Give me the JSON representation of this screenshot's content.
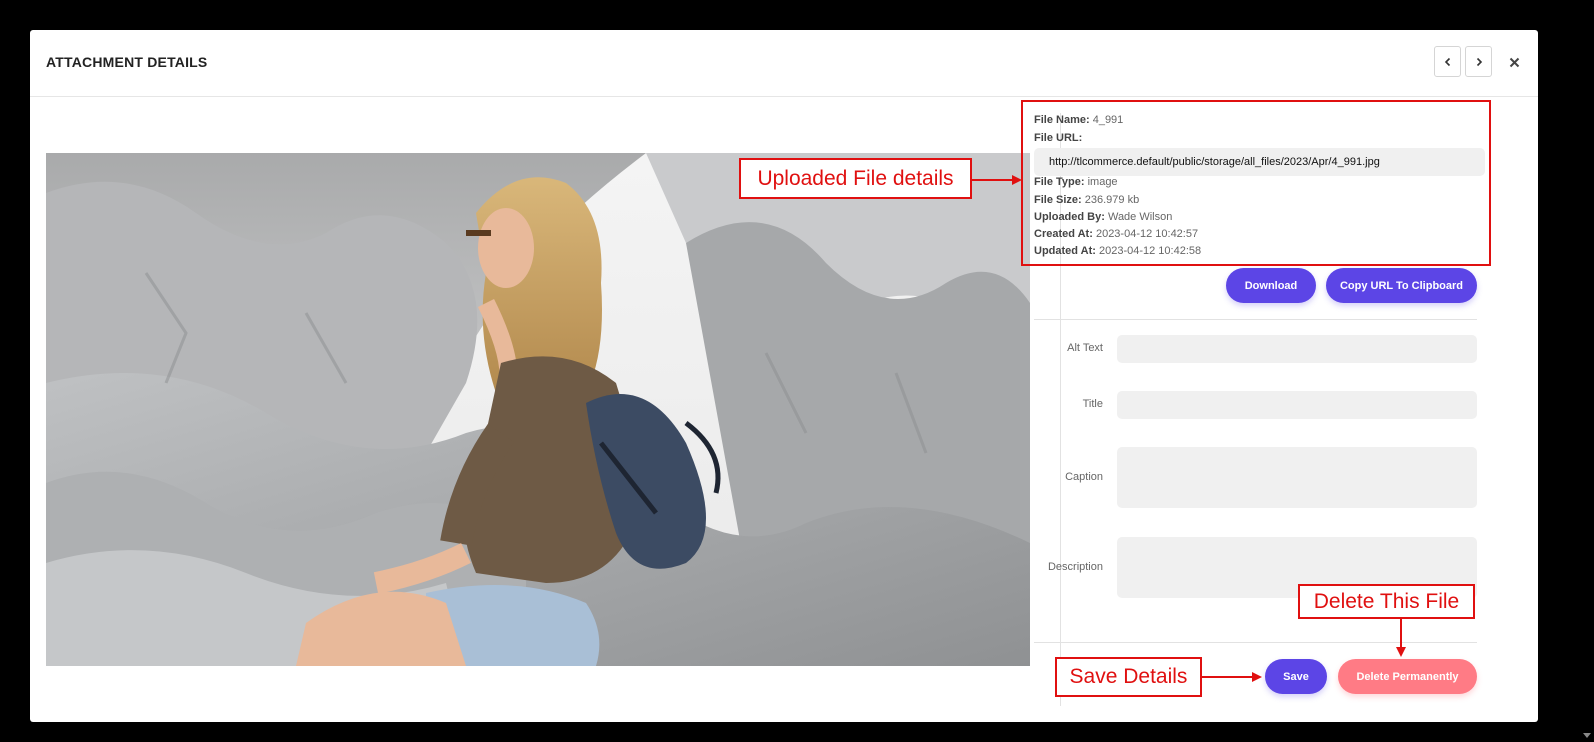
{
  "modal": {
    "title": "ATTACHMENT DETAILS"
  },
  "file": {
    "name_label": "File Name:",
    "name": "4_991",
    "url_label": "File URL:",
    "url": "http://tlcommerce.default/public/storage/all_files/2023/Apr/4_991.jpg",
    "type_label": "File Type:",
    "type": "image",
    "size_label": "File Size:",
    "size": "236.979 kb",
    "uploaded_by_label": "Uploaded By:",
    "uploaded_by": "Wade Wilson",
    "created_label": "Created At:",
    "created": "2023-04-12 10:42:57",
    "updated_label": "Updated At:",
    "updated": "2023-04-12 10:42:58"
  },
  "buttons": {
    "download": "Download",
    "copy_url": "Copy URL To Clipboard",
    "save": "Save",
    "delete": "Delete Permanently"
  },
  "form": {
    "alt_text_label": "Alt Text",
    "title_label": "Title",
    "caption_label": "Caption",
    "description_label": "Description"
  },
  "annotations": {
    "details": "Uploaded File details",
    "delete": "Delete This File",
    "save": "Save Details"
  },
  "colors": {
    "primary": "#5c45e6",
    "danger": "#ff7b85",
    "annotation": "#e01010"
  },
  "icons": {
    "prev": "chevron-left-icon",
    "next": "chevron-right-icon",
    "close": "close-icon"
  }
}
